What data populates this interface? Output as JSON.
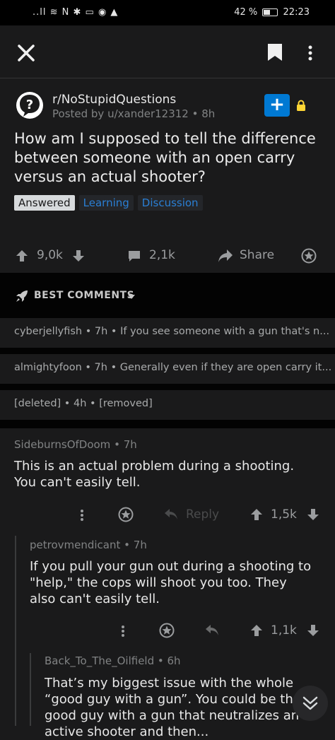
{
  "status_bar": {
    "left": "..ll ≋ N ✱ ▭ ◉ ▲",
    "battery_pct": "42 %",
    "time": "22:23"
  },
  "post": {
    "subreddit": "r/NoStupidQuestions",
    "posted_by": "Posted by u/xander12312",
    "age": "8h",
    "title": "How am I supposed to tell the difference between someone with an open carry versus an actual shooter?",
    "tags": [
      "Answered",
      "Learning",
      "Discussion"
    ],
    "upvotes": "9,0k",
    "comments_count": "2,1k",
    "share_label": "Share"
  },
  "sort": {
    "label": "BEST COMMENTS"
  },
  "collapsed_comments": [
    {
      "author": "cyberjellyfish",
      "age": "7h",
      "preview": "If you see someone with a gun that's n..."
    },
    {
      "author": "almightyfoon",
      "age": "7h",
      "preview": "Generally even if they are open carry it..."
    },
    {
      "author": "[deleted]",
      "age": "4h",
      "preview": "[removed]"
    }
  ],
  "comments": [
    {
      "author": "SideburnsOfDoom",
      "age": "7h",
      "text": "This is an actual problem during a shooting. You can't easily tell.",
      "reply_label": "Reply",
      "score": "1,5k"
    },
    {
      "author": "petrovmendicant",
      "age": "7h",
      "text": "If you pull your gun out during a shooting to \"help,\" the cops will shoot you too. They also can't easily tell.",
      "score": "1,1k"
    },
    {
      "author": "Back_To_The_Oilfield",
      "age": "6h",
      "text": "That’s my biggest issue with the whole “good guy with a gun”. You could be the good guy with a gun that neutralizes an active shooter and then..."
    }
  ],
  "colors": {
    "background": "#1a1a1b",
    "separator": "#030303",
    "accent": "#0079d3",
    "lock": "#ffd635"
  },
  "icons": [
    "close-icon",
    "bookmark-icon",
    "more-vertical-icon",
    "question-avatar-icon",
    "lock-icon",
    "upvote-icon",
    "downvote-icon",
    "comment-icon",
    "share-icon",
    "award-icon",
    "rocket-icon",
    "chevron-down-icon",
    "reply-icon",
    "double-chevron-down-icon"
  ]
}
